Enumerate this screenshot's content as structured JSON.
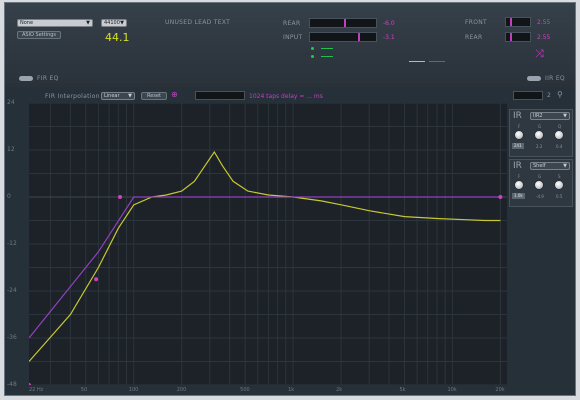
{
  "top": {
    "device_combo": "None",
    "rate_combo": "44100",
    "asio_button": "ASIO Settings",
    "sample_rate_display": "44.1",
    "unused_lead_text": "UNUSED LEAD TEXT",
    "rear_label": "REAR",
    "rear_value": "-6.0",
    "input_label": "INPUT",
    "input_value": "-3.1",
    "front_label": "FRONT",
    "front_value": "2.55",
    "rear2_label": "REAR",
    "rear2_value": "2.55",
    "fir_left": "FIR EQ",
    "fir_right": "IIR EQ",
    "colors": {
      "accent": "#d040c0",
      "green": "#20c050",
      "yellow_line": "#c8c830",
      "purple_line": "#9040c0"
    }
  },
  "toolbar": {
    "fir_interp_label": "FIR Interpolation",
    "interp_combo": "Linear",
    "reset_button": "Reset",
    "status_text": "1024 taps  delay = ... ms",
    "field_value": "2"
  },
  "graph": {
    "y_labels": [
      "24",
      "12",
      "0",
      "-12",
      "-24",
      "-36",
      "-48"
    ],
    "x_labels": [
      "22 Hz",
      "50",
      "100",
      "200",
      "500",
      "1k",
      "2k",
      "5k",
      "10k",
      "20k"
    ]
  },
  "ir1": {
    "title": "IR",
    "combo": "IIR2",
    "knob_labels": [
      "F",
      "G",
      "Q"
    ],
    "values": [
      "241",
      "2.2",
      "0.4"
    ]
  },
  "ir2": {
    "title": "IR",
    "combo": "Shelf",
    "knob_labels": [
      "F",
      "G",
      "S"
    ],
    "values": [
      "1.0k",
      "-4.9",
      "0.5"
    ]
  },
  "chart_data": {
    "type": "line",
    "xlabel": "",
    "ylabel": "",
    "x_scale": "log",
    "xlim": [
      22,
      22000
    ],
    "ylim": [
      -48,
      24
    ],
    "x_ticks": [
      "22 Hz",
      "50",
      "100",
      "200",
      "500",
      "1k",
      "2k",
      "5k",
      "10k",
      "20k"
    ],
    "y_ticks": [
      24,
      12,
      0,
      -12,
      -24,
      -36,
      -48
    ],
    "series": [
      {
        "color": "#c8c830",
        "x": [
          22,
          40,
          60,
          80,
          100,
          130,
          160,
          200,
          240,
          280,
          320,
          360,
          420,
          520,
          700,
          1000,
          1500,
          2000,
          3000,
          5000,
          8000,
          12000,
          16000,
          20000
        ],
        "y": [
          -42,
          -30,
          -18,
          -8,
          -2,
          0,
          0.5,
          1.5,
          4,
          8,
          11.5,
          8,
          4,
          1.5,
          0.5,
          0,
          -1,
          -2,
          -3.5,
          -5,
          -5.5,
          -5.8,
          -6,
          -6
        ]
      },
      {
        "color": "#9040c0",
        "x": [
          22,
          60,
          100,
          200,
          1000,
          5000,
          20000
        ],
        "y": [
          -36,
          -14,
          0,
          0,
          0,
          0,
          0
        ]
      }
    ],
    "points": [
      {
        "x": 22,
        "y": -48
      },
      {
        "x": 58,
        "y": -21
      },
      {
        "x": 82,
        "y": 0
      },
      {
        "x": 20000,
        "y": 0
      }
    ]
  }
}
